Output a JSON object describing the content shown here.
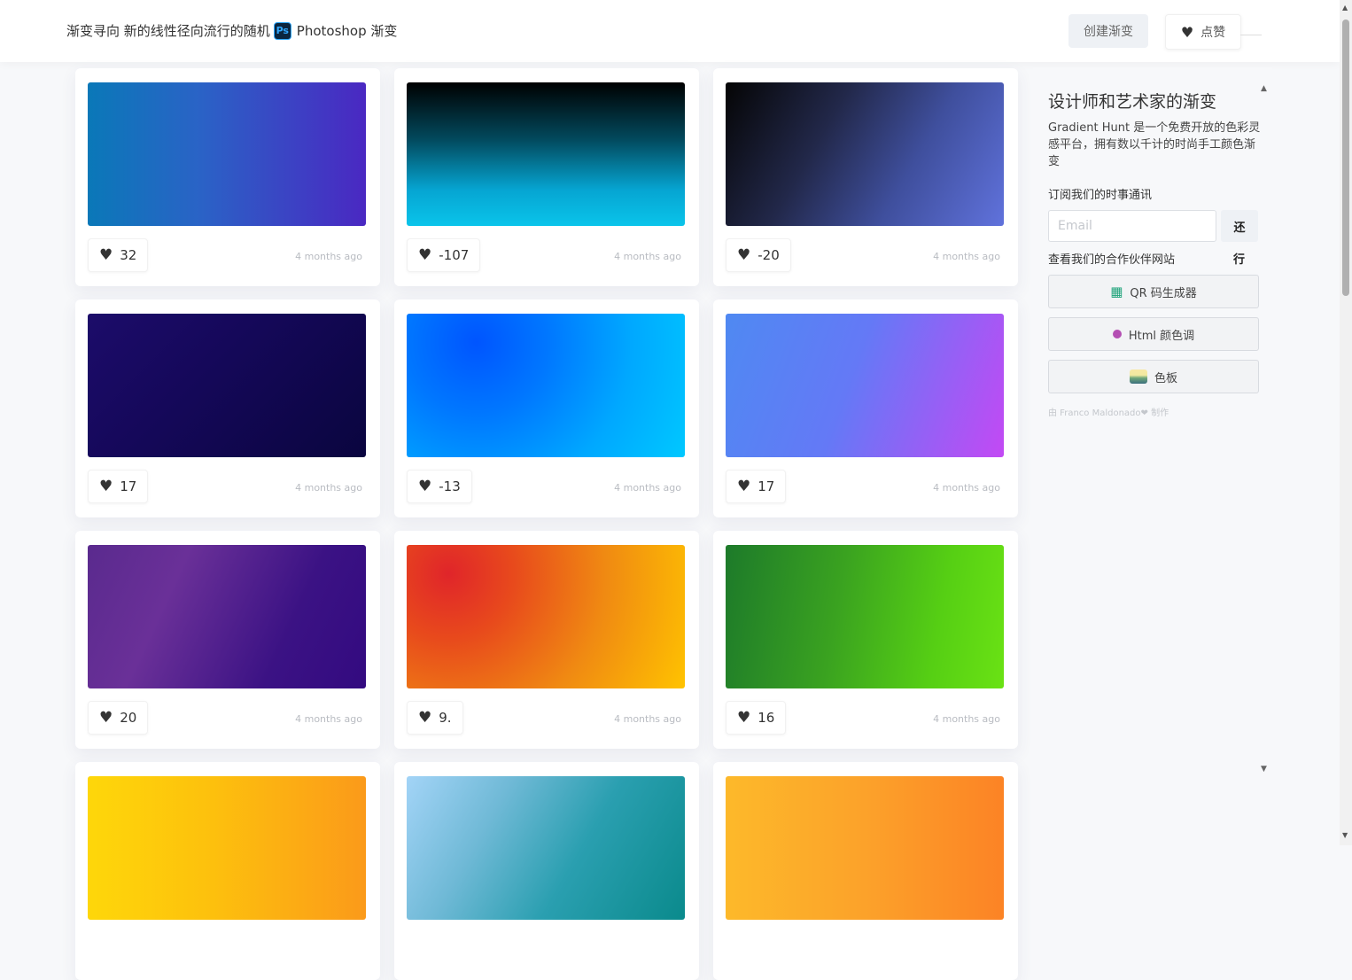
{
  "header": {
    "title_text": "渐变寻向 新的线性径向流行的随机",
    "ps_badge": "Ps",
    "title_suffix": "Photoshop 渐变",
    "create_label": "创建渐变",
    "like_label": "点赞"
  },
  "gradients": [
    {
      "likes": "32",
      "time": "4 months ago",
      "gradient": "linear-gradient(90deg, #0a78b8 0%, #2a63c6 40%, #4a28c2 100%)"
    },
    {
      "likes": "-107",
      "time": "4 months ago",
      "gradient": "linear-gradient(180deg, #000000 0%, #024a5e 40%, #06a5d2 75%, #0ac4ea 100%)"
    },
    {
      "likes": "-20",
      "time": "4 months ago",
      "gradient": "linear-gradient(120deg, #050505 0%, #22284a 35%, #3f4f9d 65%, #6072dc 100%)"
    },
    {
      "likes": "17",
      "time": "4 months ago",
      "gradient": "linear-gradient(135deg, #1c0c6a 0%, #15085a 40%, #0a053f 100%)"
    },
    {
      "likes": "-13",
      "time": "4 months ago",
      "gradient": "radial-gradient(circle at 25% 20%, #0055ff 0%, #0077ff 30%, #00a8ff 65%, #00c8ff 100%)"
    },
    {
      "likes": "17",
      "time": "4 months ago",
      "gradient": "linear-gradient(110deg, #4f89f2 0%, #6479f6 45%, #c349f4 100%)"
    },
    {
      "likes": "20",
      "time": "4 months ago",
      "gradient": "linear-gradient(115deg, #5a2a8e 0%, #6a3098 30%, #3b1284 70%, #330a80 100%)"
    },
    {
      "likes": "9.",
      "time": "4 months ago",
      "gradient": "radial-gradient(circle at 15% 20%, #e0252a 0%, #e84a1c 25%, #f08a12 60%, #ffc300 100%)"
    },
    {
      "likes": "16",
      "time": "4 months ago",
      "gradient": "linear-gradient(100deg, #1d7a2a 0%, #3aa220 40%, #56cf14 75%, #6ae214 100%)"
    },
    {
      "likes": "",
      "time": "",
      "gradient": "linear-gradient(90deg, #fed70a 0%, #fdc00d 45%, #fb9a1a 100%)"
    },
    {
      "likes": "",
      "time": "",
      "gradient": "linear-gradient(120deg, #a3d4f7 0%, #6fb9d6 30%, #2a9fb0 60%, #0a8a8c 100%)"
    },
    {
      "likes": "",
      "time": "",
      "gradient": "linear-gradient(90deg, #fdb92a 0%, #fca22a 50%, #fc8325 100%)"
    }
  ],
  "sidebar": {
    "title": "设计师和艺术家的渐变",
    "description": "Gradient Hunt 是一个免费开放的色彩灵感平台，拥有数以千计的时尚手工颜色渐变",
    "subscribe_label": "订阅我们的时事通讯",
    "email_placeholder": "Email",
    "submit_label": "还",
    "partners_label": "查看我们的合作伙伴网站",
    "submit_label_2": "行",
    "partner_buttons": [
      {
        "label": "QR 码生成器",
        "icon": "qr-code-icon"
      },
      {
        "label": "Html 颜色调",
        "icon": "color-dot-icon"
      },
      {
        "label": "色板",
        "icon": "palette-icon"
      }
    ],
    "credit": "由 Franco Maldonado❤ 制作"
  }
}
